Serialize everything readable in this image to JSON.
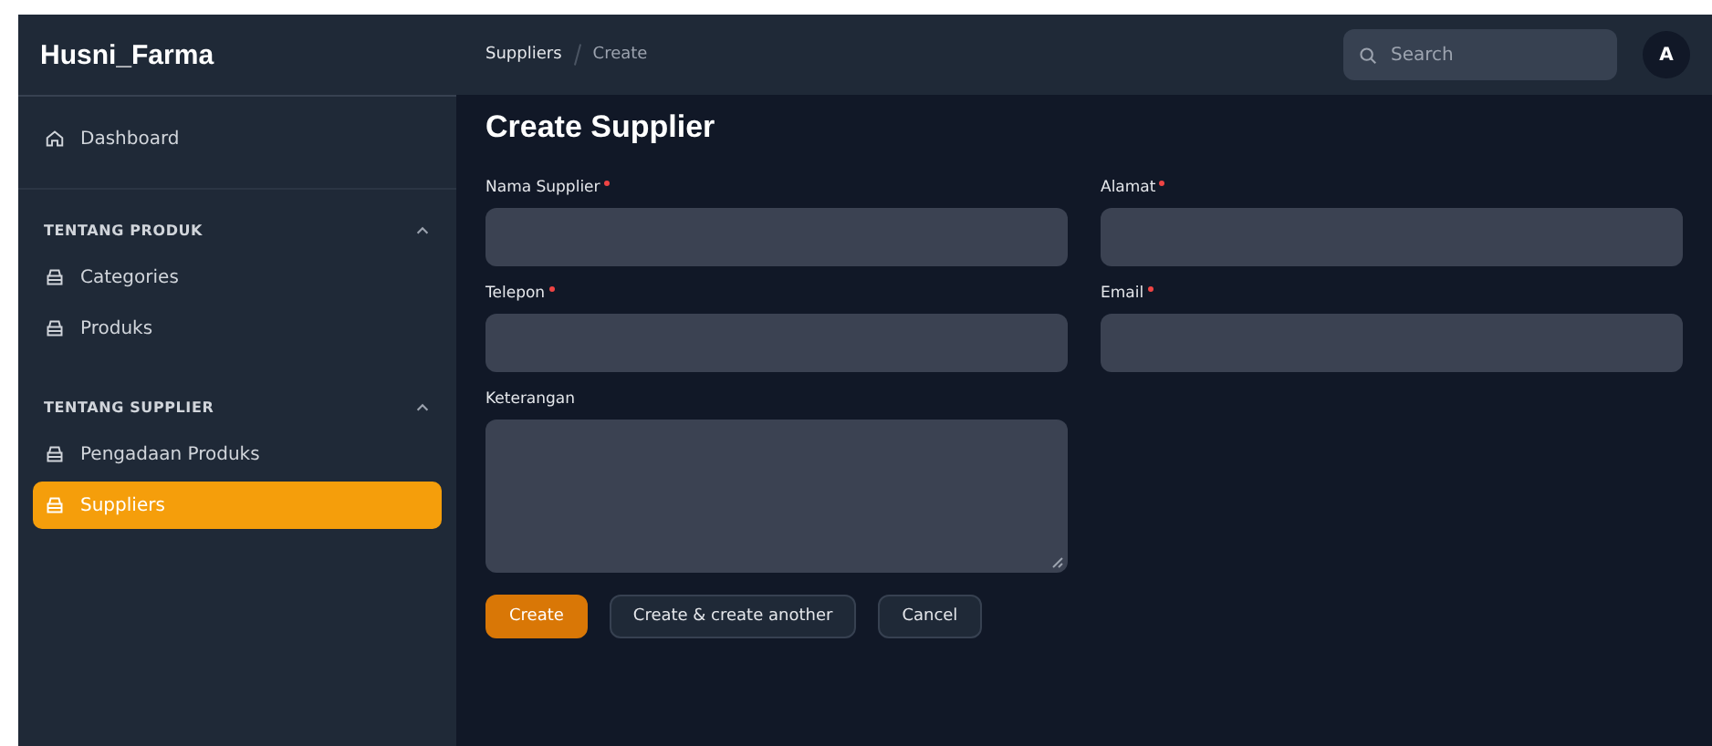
{
  "brand": "Husni_Farma",
  "sidebar": {
    "top": [
      {
        "label": "Dashboard",
        "selected": false
      }
    ],
    "groups": [
      {
        "title": "TENTANG PRODUK",
        "expanded": true,
        "items": [
          {
            "label": "Categories",
            "selected": false
          },
          {
            "label": "Produks",
            "selected": false
          }
        ]
      },
      {
        "title": "TENTANG SUPPLIER",
        "expanded": true,
        "items": [
          {
            "label": "Pengadaan Produks",
            "selected": false
          },
          {
            "label": "Suppliers",
            "selected": true
          }
        ]
      }
    ]
  },
  "breadcrumbs": [
    "Suppliers",
    "Create"
  ],
  "search": {
    "placeholder": "Search"
  },
  "avatar": "A",
  "page_title": "Create Supplier",
  "fields": [
    {
      "label": "Nama Supplier",
      "required": true,
      "kind": "input"
    },
    {
      "label": "Alamat",
      "required": true,
      "kind": "input"
    },
    {
      "label": "Telepon",
      "required": true,
      "kind": "input"
    },
    {
      "label": "Email",
      "required": true,
      "kind": "input"
    },
    {
      "label": "Keterangan",
      "required": false,
      "kind": "textarea"
    }
  ],
  "buttons": [
    {
      "label": "Create",
      "kind": "primary"
    },
    {
      "label": "Create & create another",
      "kind": "secondary"
    },
    {
      "label": "Cancel",
      "kind": "secondary"
    }
  ]
}
